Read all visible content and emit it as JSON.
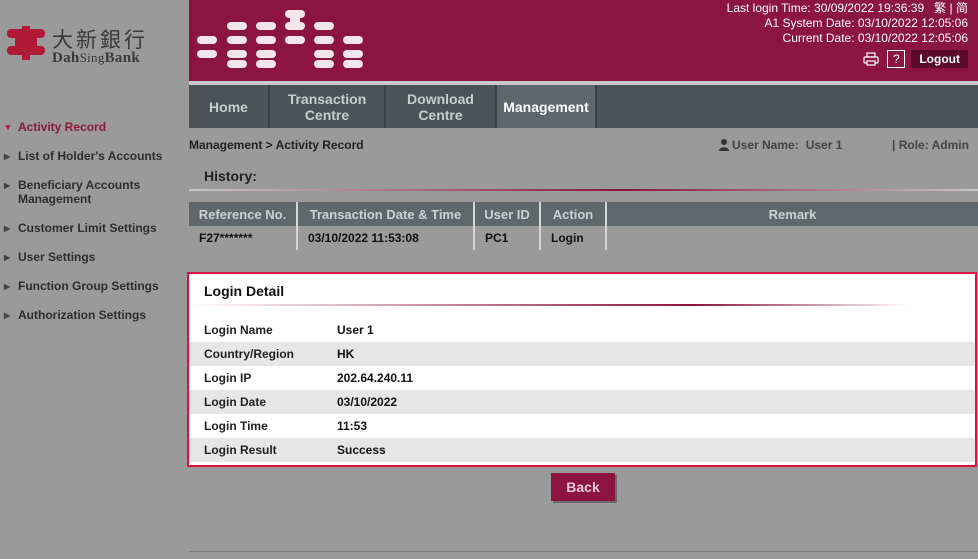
{
  "brand": {
    "name_zh": "大新銀行",
    "name_en_prefix": "Dah",
    "name_en_mid": "Sing",
    "name_en_suffix": "Bank"
  },
  "header": {
    "last_login": "Last login Time: 30/09/2022 19:36:39",
    "lang_trad": "繁",
    "lang_sep": "|",
    "lang_simp": "简",
    "system_date": "A1 System Date: 03/10/2022 12:05:06",
    "current_date": "Current Date: 03/10/2022 12:05:06",
    "help_label": "?",
    "logout_label": "Logout"
  },
  "sidebar": {
    "items": [
      {
        "label": "Activity Record",
        "active": true
      },
      {
        "label": "List of Holder's Accounts",
        "active": false
      },
      {
        "label": "Beneficiary Accounts Management",
        "active": false
      },
      {
        "label": "Customer Limit Settings",
        "active": false
      },
      {
        "label": "User Settings",
        "active": false
      },
      {
        "label": "Function Group Settings",
        "active": false
      },
      {
        "label": "Authorization Settings",
        "active": false
      }
    ]
  },
  "topnav": {
    "tabs": [
      {
        "label": "Home"
      },
      {
        "label": "Transaction Centre"
      },
      {
        "label": "Download Centre"
      },
      {
        "label": "Management"
      }
    ]
  },
  "page": {
    "breadcrumb": "Management > Activity Record",
    "user_label": "User Name:",
    "user_value": "User 1",
    "role": "| Role: Admin",
    "history_title": "History:"
  },
  "history": {
    "columns": [
      "Reference No.",
      "Transaction Date & Time",
      "User ID",
      "Action",
      "Remark"
    ],
    "rows": [
      [
        "F27*******",
        "03/10/2022 11:53:08",
        "PC1",
        "Login",
        ""
      ]
    ]
  },
  "login_detail": {
    "title": "Login Detail",
    "fields": [
      {
        "label": "Login Name",
        "value": "User 1"
      },
      {
        "label": "Country/Region",
        "value": "HK"
      },
      {
        "label": "Login IP",
        "value": "202.64.240.11"
      },
      {
        "label": "Login Date",
        "value": "03/10/2022"
      },
      {
        "label": "Login Time",
        "value": "11:53"
      },
      {
        "label": "Login Result",
        "value": "Success"
      }
    ]
  },
  "back_label": "Back",
  "colors": {
    "brand": "#8b1440",
    "highlight_border": "#e0103c",
    "nav_bg": "#4b5357",
    "page_bg": "#9a9a9a"
  },
  "icons": {
    "user": "user-icon",
    "print": "print-icon",
    "nav_arrow": "triangle-right-icon",
    "nav_arrow_active": "triangle-down-icon"
  }
}
